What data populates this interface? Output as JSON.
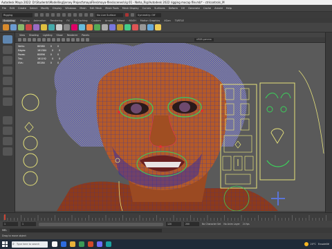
{
  "window": {
    "title": "Autodesk Maya 2022: D:\\Students\\Modelling\\Jersey Project\\mayaFiles\\maya-files\\scenes\\rig 01 - Neha_Rig\\Autodesk 2022 rigging mocap file.mb* - ctrlcontrols_M"
  },
  "menubar": {
    "items": [
      "File",
      "Edit",
      "Create",
      "Select",
      "Modify",
      "Display",
      "Windows",
      "Mesh",
      "Edit Mesh",
      "Mesh Tools",
      "Mesh Display",
      "Curves",
      "Surfaces",
      "Deform",
      "UV",
      "Generate",
      "Cache",
      "Arnold",
      "Help"
    ]
  },
  "statusline": {
    "mode": "Rigging",
    "search_placeholder": "No Live Surface",
    "symmetry": "Symmetry: Off"
  },
  "shelf": {
    "tabs": [
      "Sculpting",
      "Rigging",
      "Animation",
      "Rendering",
      "FX",
      "FX Caching",
      "Custom",
      "Arnold",
      "Bifrost",
      "MASH",
      "Motion Graphics",
      "XGen",
      "TURTLE"
    ],
    "active_tab": "Sculpting"
  },
  "panel": {
    "menu": [
      "View",
      "Shading",
      "Lighting",
      "Show",
      "Renderer",
      "Panels"
    ],
    "camera_label": "sRGB gamma"
  },
  "hud": {
    "rows": [
      {
        "key": "Verts:",
        "v1": "80580",
        "v2": "0",
        "v3": "0"
      },
      {
        "key": "Edges:",
        "v1": "161384",
        "v2": "0",
        "v3": "0"
      },
      {
        "key": "Faces:",
        "v1": "80896",
        "v2": "0",
        "v3": "0"
      },
      {
        "key": "Tris:",
        "v1": "161192",
        "v2": "0",
        "v3": "0"
      },
      {
        "key": "UVs:",
        "v1": "85284",
        "v2": "0",
        "v3": "0"
      }
    ]
  },
  "range": {
    "start": "1",
    "end": "120",
    "anim_start": "1",
    "anim_end": "200",
    "character_set": "No Character Set",
    "anim_layer": "No Anim Layer",
    "fps": "24 fps"
  },
  "cmdline": {
    "label": "MEL"
  },
  "helpline": {
    "text": "Drag to move object"
  },
  "taskbar": {
    "search_placeholder": "Type here to search",
    "weather": "20°C",
    "weather_label": "Ensoleillé",
    "app_colors": [
      "#f6f6f6",
      "#2d6cdf",
      "#e7b13a",
      "#3c9b58",
      "#d24a2b",
      "#6d6dff",
      "#1aa0a0"
    ]
  },
  "colors": {
    "mesh_wire": "#2633c8",
    "skin": "#b35a2a",
    "controls": "#e6e27a",
    "green_ctrl": "#3bd25a"
  }
}
